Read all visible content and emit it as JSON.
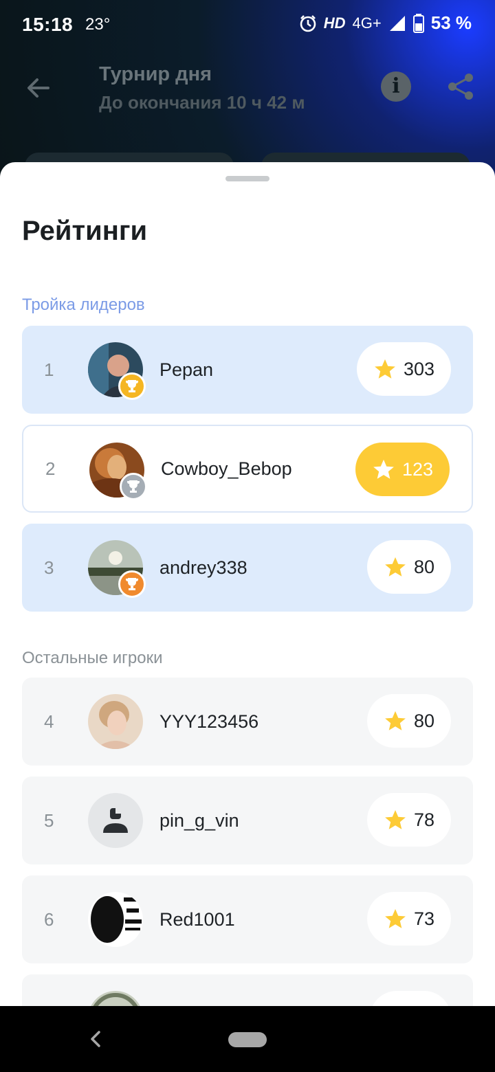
{
  "status_bar": {
    "time": "15:18",
    "temperature": "23°",
    "hd": "HD",
    "network": "4G+",
    "battery": "53 %"
  },
  "header": {
    "title": "Турнир дня",
    "subtitle": "До окончания 10 ч 42 м"
  },
  "sheet": {
    "title": "Рейтинги",
    "leaders_label": "Тройка лидеров",
    "others_label": "Остальные игроки"
  },
  "leaders": [
    {
      "rank": "1",
      "name": "Pepan",
      "score": "303",
      "medal": "gold",
      "medal_color": "#f5b623"
    },
    {
      "rank": "2",
      "name": "Cowboy_Bebop",
      "score": "123",
      "medal": "silver",
      "medal_color": "#a5adb5"
    },
    {
      "rank": "3",
      "name": "andrey338",
      "score": "80",
      "medal": "bronze",
      "medal_color": "#f08a2e"
    }
  ],
  "others": [
    {
      "rank": "4",
      "name": "YYY123456",
      "score": "80"
    },
    {
      "rank": "5",
      "name": "pin_g_vin",
      "score": "78"
    },
    {
      "rank": "6",
      "name": "Red1001",
      "score": "73"
    }
  ],
  "colors": {
    "accent_blue_label": "#7b9be6",
    "leader_bg": "#deebfc",
    "star": "#fdcb36",
    "own_score_bg": "#fdcb36"
  }
}
